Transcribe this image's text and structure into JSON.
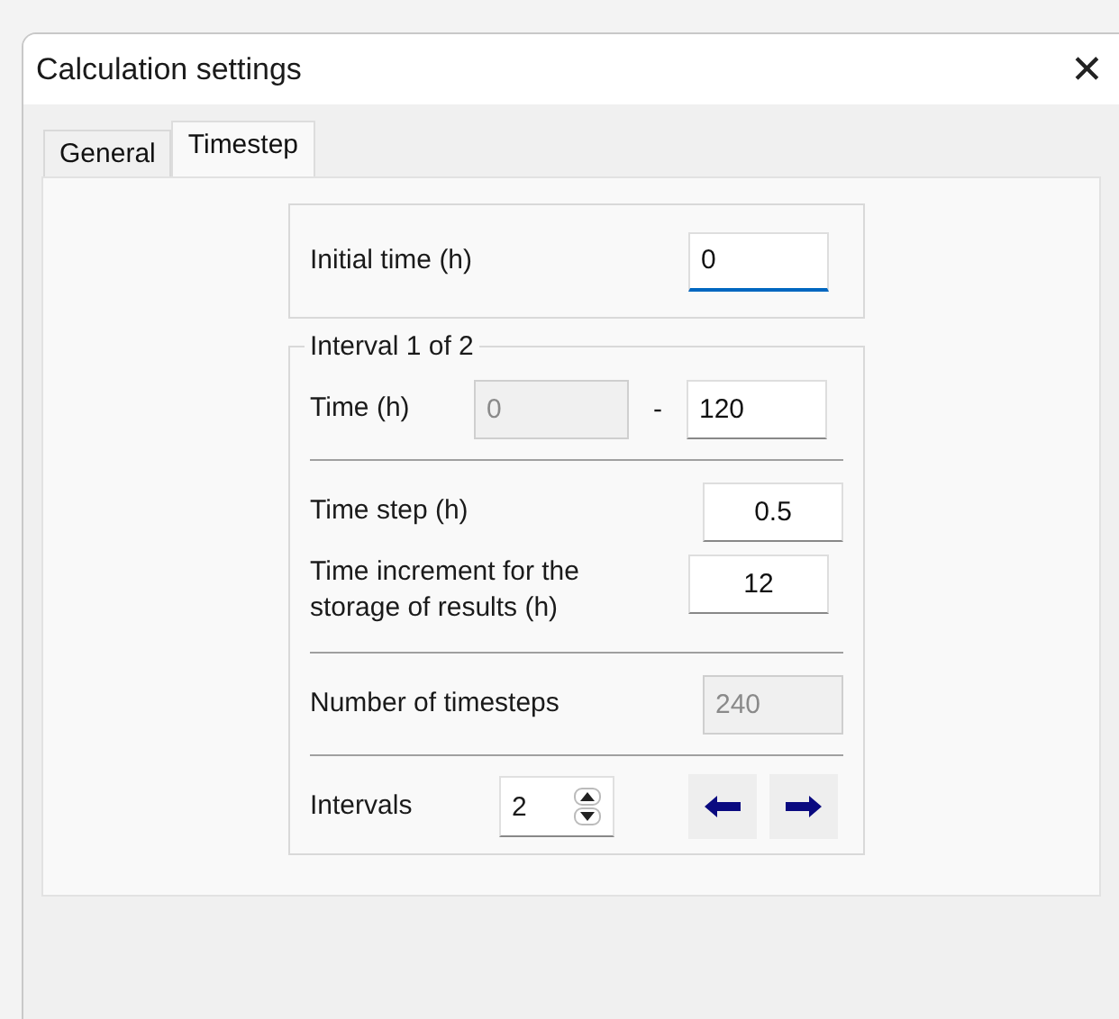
{
  "window": {
    "title": "Calculation settings",
    "close": "✕"
  },
  "tabs": [
    {
      "label": "General",
      "selected": false
    },
    {
      "label": "Timestep",
      "selected": true
    }
  ],
  "initial_time": {
    "label": "Initial time (h)",
    "value": "0",
    "focused": true
  },
  "interval": {
    "legend": "Interval 1 of 2",
    "time_label": "Time (h)",
    "start": {
      "value": "0",
      "disabled": true
    },
    "separator": "-",
    "end": {
      "value": "120",
      "disabled": false
    }
  },
  "time_step": {
    "label": "Time step (h)",
    "value": "0.5"
  },
  "storage_increment": {
    "label": "Time increment for the storage of results (h)",
    "value": "12"
  },
  "timesteps": {
    "label": "Number of timesteps",
    "value": "240",
    "disabled": true
  },
  "intervals": {
    "label": "Intervals",
    "value": "2"
  }
}
